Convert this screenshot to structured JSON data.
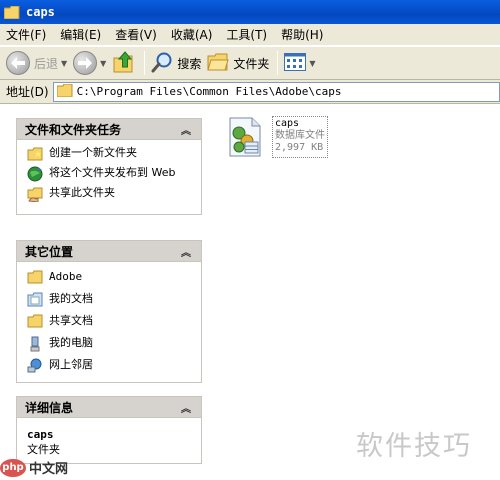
{
  "window": {
    "title": "caps"
  },
  "menu": {
    "items": [
      {
        "label": "文件(F)"
      },
      {
        "label": "编辑(E)"
      },
      {
        "label": "查看(V)"
      },
      {
        "label": "收藏(A)"
      },
      {
        "label": "工具(T)"
      },
      {
        "label": "帮助(H)"
      }
    ]
  },
  "toolbar": {
    "back_label": "后退",
    "search_label": "搜索",
    "folders_label": "文件夹"
  },
  "address": {
    "label": "地址(D)",
    "path": "C:\\Program Files\\Common Files\\Adobe\\caps"
  },
  "tasks_panel": {
    "title": "文件和文件夹任务",
    "items": [
      {
        "label": "创建一个新文件夹",
        "icon": "new-folder-icon"
      },
      {
        "label": "将这个文件夹发布到 Web",
        "icon": "publish-web-icon"
      },
      {
        "label": "共享此文件夹",
        "icon": "share-folder-icon"
      }
    ]
  },
  "places_panel": {
    "title": "其它位置",
    "items": [
      {
        "label": "Adobe",
        "icon": "folder-icon"
      },
      {
        "label": "我的文档",
        "icon": "my-documents-icon"
      },
      {
        "label": "共享文档",
        "icon": "shared-documents-icon"
      },
      {
        "label": "我的电脑",
        "icon": "my-computer-icon"
      },
      {
        "label": "网上邻居",
        "icon": "network-places-icon"
      }
    ]
  },
  "details_panel": {
    "title": "详细信息",
    "name": "caps",
    "type": "文件夹"
  },
  "file": {
    "name": "caps",
    "type": "数据库文件",
    "size": "2,997 KB"
  },
  "watermark": {
    "right_text": "软件技巧",
    "logo_text": "php",
    "logo_caption": "中文网"
  },
  "colors": {
    "titlebar": "#0348c0",
    "chrome": "#ece9d8",
    "panel_header": "#d6d3ce"
  }
}
